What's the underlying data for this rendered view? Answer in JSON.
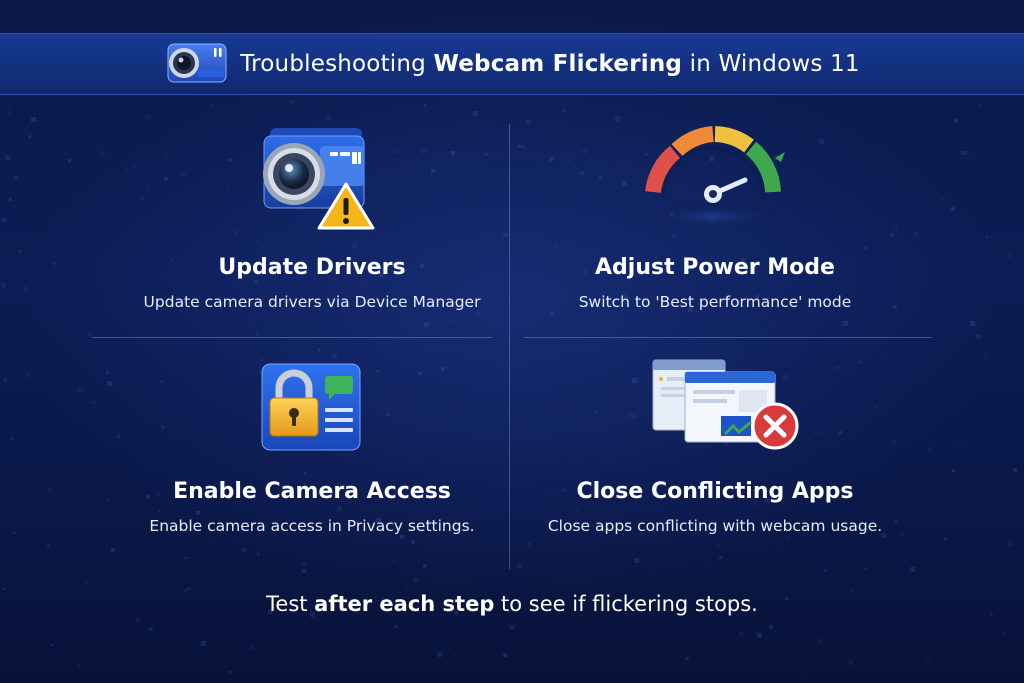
{
  "header": {
    "icon": "webcam-icon",
    "title_prefix": "Troubleshooting ",
    "title_bold": "Webcam Flickering",
    "title_suffix": " in Windows 11"
  },
  "steps": [
    {
      "icon": "webcam-warning-icon",
      "title": "Update Drivers",
      "description": "Update camera drivers via Device Manager"
    },
    {
      "icon": "performance-gauge-icon",
      "title": "Adjust Power Mode",
      "description": "Switch to 'Best performance' mode"
    },
    {
      "icon": "privacy-lock-icon",
      "title": "Enable Camera Access",
      "description": "Enable camera access in Privacy settings."
    },
    {
      "icon": "close-apps-icon",
      "title": "Close Conflicting Apps",
      "description": "Close apps conflicting with webcam usage."
    }
  ],
  "footer": {
    "prefix": "Test ",
    "bold": "after each step",
    "suffix": " to see if flickering stops."
  },
  "colors": {
    "background": "#0b1a4a",
    "header_bar": "#143180",
    "warning": "#f5b718",
    "gauge_red": "#e0504a",
    "gauge_orange": "#f0a030",
    "gauge_green": "#3ea84a",
    "error_red": "#d83b3b",
    "lock_gold": "#f2b32a"
  }
}
